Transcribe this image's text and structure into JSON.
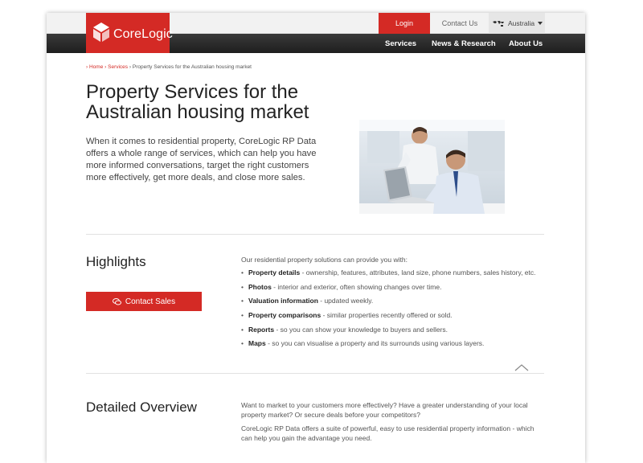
{
  "header": {
    "brand": "CoreLogic",
    "login_label": "Login",
    "contact_label": "Contact Us",
    "country_label": "Australia",
    "nav": [
      "Services",
      "News & Research",
      "About Us"
    ]
  },
  "breadcrumb": {
    "home": "Home",
    "services": "Services",
    "current": "Property Services for the Australian housing market"
  },
  "hero": {
    "title": "Property Services for the Australian housing market",
    "intro": "When it comes to residential property, CoreLogic RP Data offers a whole range of services, which can help you have more informed conversations, target the right customers more effectively, get more deals, and close more sales."
  },
  "highlights": {
    "heading": "Highlights",
    "contact_button": "Contact Sales",
    "lead": "Our residential property solutions can provide you with:",
    "items": [
      {
        "term": "Property details",
        "desc": " - ownership, features, attributes, land size, phone numbers, sales history, etc."
      },
      {
        "term": "Photos",
        "desc": " - interior and exterior, often showing changes over time."
      },
      {
        "term": "Valuation information",
        "desc": " - updated weekly."
      },
      {
        "term": "Property comparisons",
        "desc": " - similar properties recently offered or sold."
      },
      {
        "term": "Reports",
        "desc": " - so you can show your knowledge to buyers and sellers."
      },
      {
        "term": "Maps",
        "desc": " - so you can visualise a property and its surrounds using various layers."
      }
    ]
  },
  "overview": {
    "heading": "Detailed Overview",
    "para1": "Want to market to your customers more effectively? Have a greater understanding of your local property market? Or secure deals before your competitors?",
    "para2": "CoreLogic RP Data offers a suite of powerful, easy to use residential property information - which can help you gain the advantage you need."
  },
  "colors": {
    "brand_red": "#d42a25",
    "nav_dark": "#2a2a2a"
  },
  "icons": [
    "cube-logo-icon",
    "world-map-icon",
    "caret-down-icon",
    "chat-bubble-icon",
    "chevron-up-icon"
  ]
}
